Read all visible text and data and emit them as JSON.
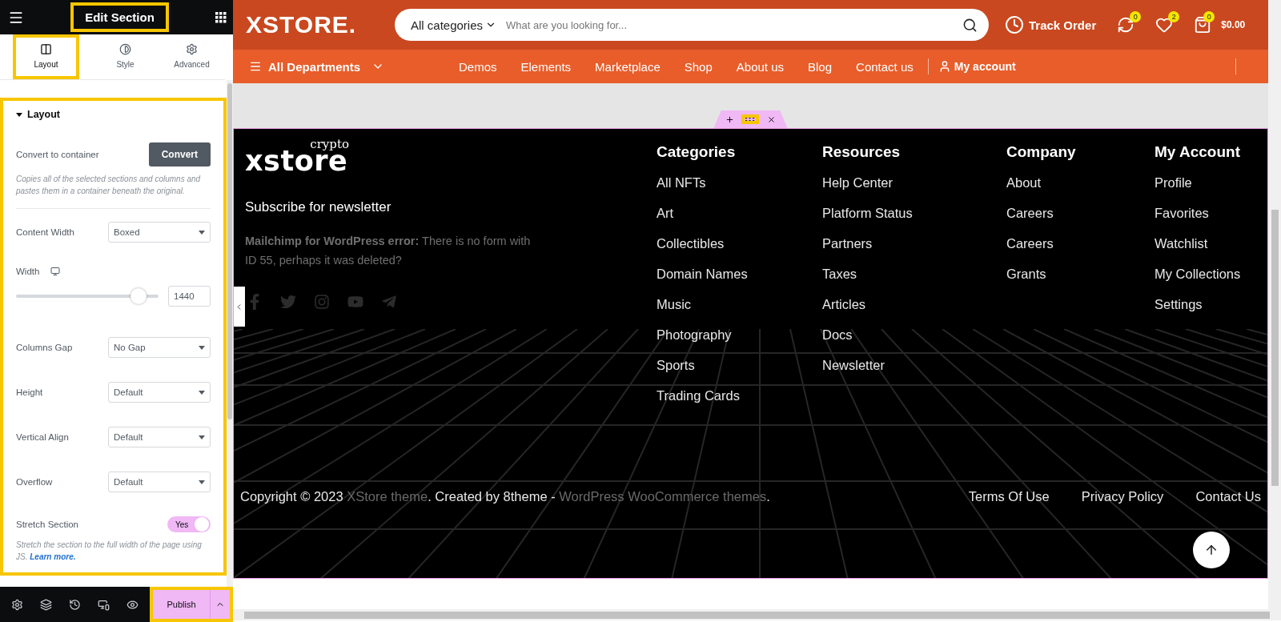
{
  "editor": {
    "title": "Edit Section",
    "title_highlighted": true,
    "tabs": [
      {
        "kind": "layout",
        "label": "Layout",
        "selected": true,
        "highlighted": true
      },
      {
        "kind": "style",
        "label": "Style",
        "selected": false,
        "highlighted": false
      },
      {
        "kind": "advanced",
        "label": "Advanced",
        "selected": false,
        "highlighted": false
      }
    ],
    "section": {
      "title": "Layout",
      "expanded": true,
      "highlighted": true,
      "convert": {
        "label": "Convert to container",
        "button": "Convert",
        "help": "Copies all of the selected sections and columns and pastes them in a container beneath the original."
      },
      "controls": [
        {
          "kind": "select",
          "label": "Content Width",
          "value": "Boxed"
        },
        {
          "kind": "slider",
          "label": "Width",
          "level": 0.86,
          "value": "1440"
        },
        {
          "kind": "select",
          "label": "Columns Gap",
          "value": "No Gap"
        },
        {
          "kind": "select",
          "label": "Height",
          "value": "Default"
        },
        {
          "kind": "select",
          "label": "Vertical Align",
          "value": "Default"
        },
        {
          "kind": "select",
          "label": "Overflow",
          "value": "Default"
        },
        {
          "kind": "switch",
          "label": "Stretch Section",
          "on": true,
          "state_label": "Yes",
          "help": "Stretch the section to the full width of the page using JS.",
          "link": "Learn more."
        }
      ]
    },
    "publish": {
      "label": "Publish",
      "highlighted": true
    }
  },
  "store": {
    "logo": "XSTORE.",
    "search": {
      "category": "All categories",
      "placeholder": "What are you looking for..."
    },
    "track": "Track Order",
    "compare_count": "0",
    "wishlist_count": "2",
    "cart_count": "0",
    "cart_total": "$0.00",
    "departments": "All Departments",
    "nav": [
      "Demos",
      "Elements",
      "Marketplace",
      "Shop",
      "About us",
      "Blog",
      "Contact us"
    ],
    "account": "My account"
  },
  "handle": {
    "highlighted": true
  },
  "footer": {
    "logo_sup": "crypto",
    "logo": "xstore",
    "subscribe": "Subscribe for newsletter",
    "error": "**Mailchimp for WordPress error:** There is no form with ID 55, perhaps it was deleted?",
    "columns": [
      {
        "title": "Categories",
        "links": [
          "All NFTs",
          "Art",
          "Collectibles",
          "Domain Names",
          "Music",
          "Photography",
          "Sports",
          "Trading Cards"
        ]
      },
      {
        "title": "Resources",
        "links": [
          "Help Center",
          "Platform Status",
          "Partners",
          "Taxes",
          "Articles",
          "Docs",
          "Newsletter"
        ]
      },
      {
        "title": "Company",
        "links": [
          "About",
          "Careers",
          "Careers",
          "Grants"
        ]
      },
      {
        "title": "My Account",
        "links": [
          "Profile",
          "Favorites",
          "Watchlist",
          "My Collections",
          "Settings"
        ]
      }
    ],
    "copyright": [
      {
        "text": "Copyright © 2023 ",
        "link": false
      },
      {
        "text": "XStore theme",
        "link": true
      },
      {
        "text": ". Created by 8theme - ",
        "link": false
      },
      {
        "text": "WordPress WooCommerce themes",
        "link": true
      },
      {
        "text": ".",
        "link": false
      }
    ],
    "legal": [
      "Terms Of Use",
      "Privacy Policy",
      "Contact Us"
    ]
  }
}
